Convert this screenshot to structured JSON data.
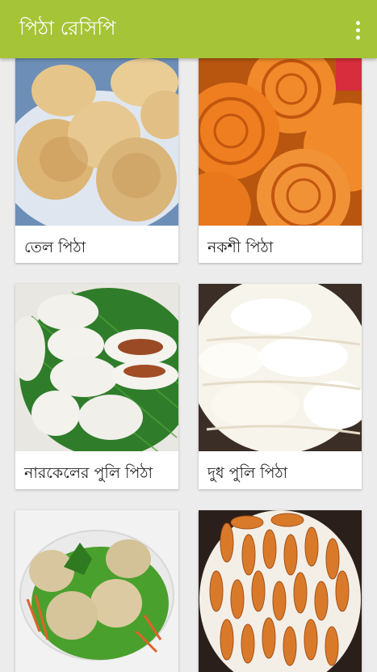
{
  "app": {
    "title": "পিঠা রেসিপি"
  },
  "colors": {
    "appbar": "#a5c437",
    "background": "#ececec"
  },
  "icons": {
    "menu": "more-vertical-icon"
  },
  "recipes": [
    {
      "label": "তেল পিঠা"
    },
    {
      "label": "নকশী পিঠা"
    },
    {
      "label": "নারকেলের পুলি পিঠা"
    },
    {
      "label": "দুধ পুলি পিঠা"
    },
    {
      "label": ""
    },
    {
      "label": ""
    }
  ]
}
